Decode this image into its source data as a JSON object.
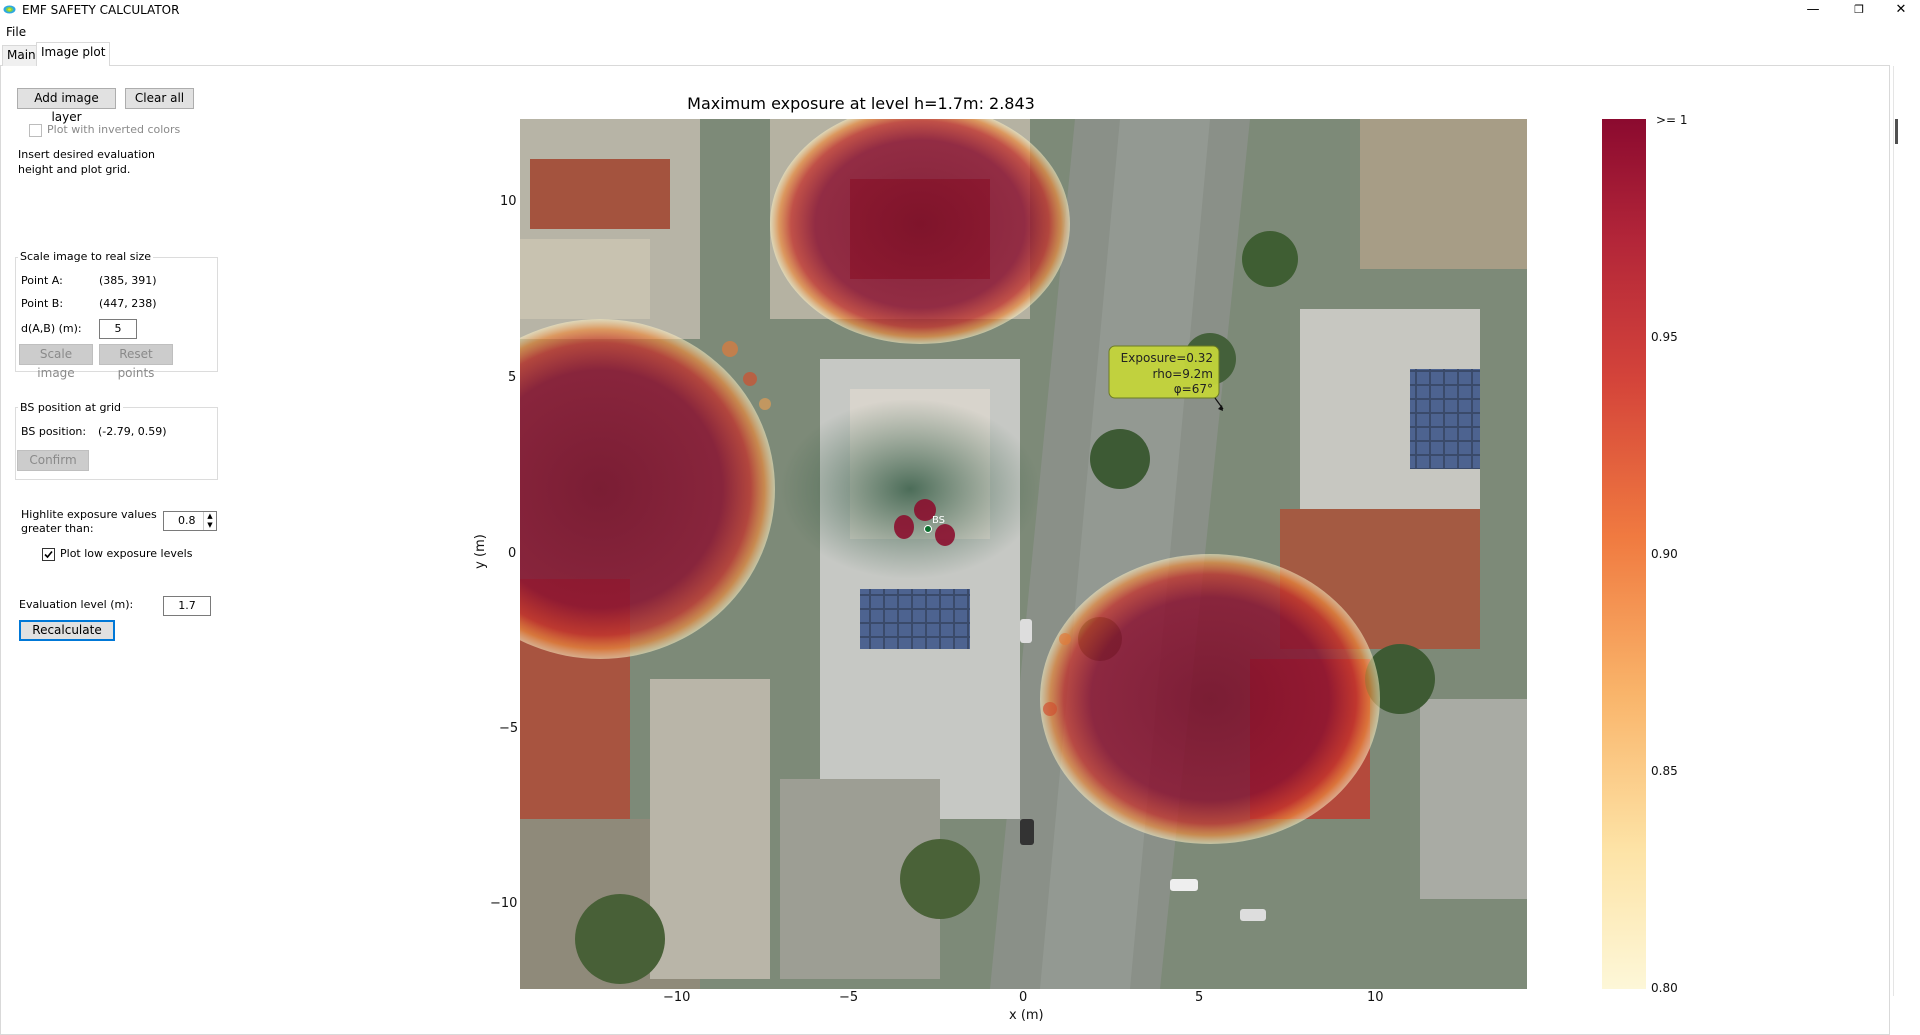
{
  "window": {
    "title": "EMF SAFETY CALCULATOR",
    "minimize_icon": "minimize-icon",
    "restore_icon": "restore-icon",
    "close_icon": "close-icon"
  },
  "menu": {
    "file": "File"
  },
  "tabs": [
    {
      "label": "Main",
      "active": false
    },
    {
      "label": "Image plot",
      "active": true
    }
  ],
  "left_panel": {
    "add_image_layer": "Add image layer",
    "clear_all": "Clear all",
    "plot_inverted_colors": {
      "label": "Plot with inverted colors",
      "checked": false,
      "enabled": false
    },
    "instruction_line1": "Insert desired evaluation",
    "instruction_line2": "height and plot grid.",
    "scale_group": {
      "title": "Scale image to real size",
      "point_a_label": "Point A:",
      "point_a_value": "(385, 391)",
      "point_b_label": "Point B:",
      "point_b_value": "(447, 238)",
      "distance_label": "d(A,B) (m):",
      "distance_value": "5",
      "scale_button": "Scale image",
      "reset_button": "Reset points"
    },
    "bs_group": {
      "title": "BS position at grid",
      "position_label": "BS position:",
      "position_value": "(-2.79, 0.59)",
      "confirm_button": "Confirm"
    },
    "highlight_label_line1": "Highlite exposure values",
    "highlight_label_line2": "greater than:",
    "highlight_value": "0.8",
    "plot_low_exposure": {
      "label": "Plot low exposure levels",
      "checked": true
    },
    "eval_level_label": "Evaluation level (m):",
    "eval_level_value": "1.7",
    "recalculate_button": "Recalculate"
  },
  "plot": {
    "title": "Maximum exposure at level h=1.7m: 2.843",
    "xlabel": "x (m)",
    "ylabel": "y (m)",
    "x_ticks": [
      "−10",
      "−5",
      "0",
      "5",
      "10"
    ],
    "y_ticks": [
      "10",
      "5",
      "0",
      "−5",
      "−10"
    ],
    "bs_label": "BS",
    "tooltip_line1": "Exposure=0.32",
    "tooltip_line2": "rho=9.2m",
    "tooltip_line3": "φ=67°",
    "colorbar_ticks": [
      ">= 1",
      "0.95",
      "0.90",
      "0.85",
      "0.80"
    ],
    "colormap": {
      "high": "#8b0a2f",
      "mid": "#f08030",
      "low": "#fdf5d0"
    }
  }
}
